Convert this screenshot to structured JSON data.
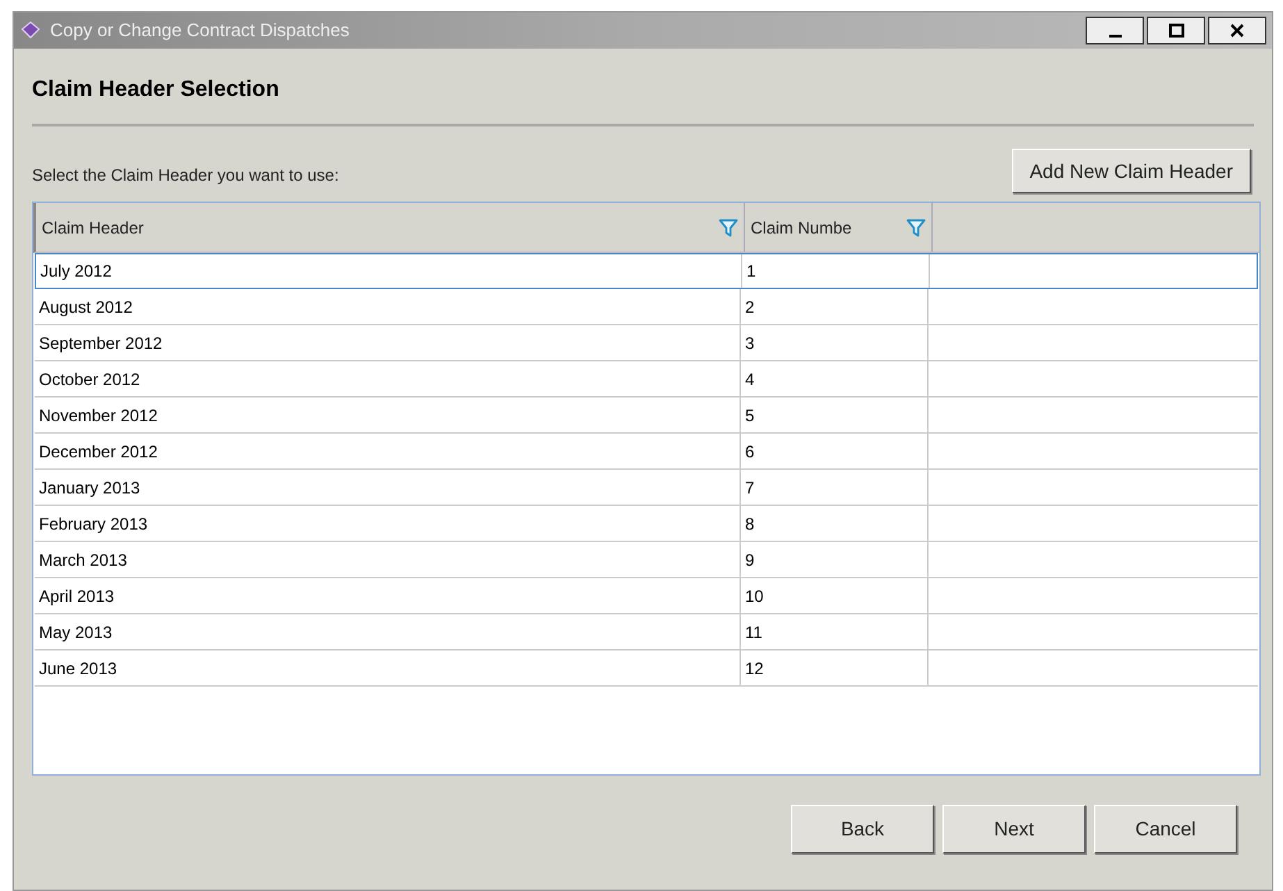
{
  "window": {
    "title": "Copy or Change Contract Dispatches"
  },
  "heading": "Claim Header Selection",
  "prompt": "Select the Claim Header you want to use:",
  "add_button": "Add New Claim Header",
  "table": {
    "columns": [
      {
        "label": "Claim Header",
        "filter": true
      },
      {
        "label": "Claim Numbe",
        "filter": true
      }
    ],
    "rows": [
      {
        "cells": [
          "July 2012",
          "1"
        ],
        "selected": true
      },
      {
        "cells": [
          "August 2012",
          "2"
        ],
        "selected": false
      },
      {
        "cells": [
          "September 2012",
          "3"
        ],
        "selected": false
      },
      {
        "cells": [
          "October 2012",
          "4"
        ],
        "selected": false
      },
      {
        "cells": [
          "November 2012",
          "5"
        ],
        "selected": false
      },
      {
        "cells": [
          "December 2012",
          "6"
        ],
        "selected": false
      },
      {
        "cells": [
          "January 2013",
          "7"
        ],
        "selected": false
      },
      {
        "cells": [
          "February 2013",
          "8"
        ],
        "selected": false
      },
      {
        "cells": [
          "March 2013",
          "9"
        ],
        "selected": false
      },
      {
        "cells": [
          "April 2013",
          "10"
        ],
        "selected": false
      },
      {
        "cells": [
          "May 2013",
          "11"
        ],
        "selected": false
      },
      {
        "cells": [
          "June 2013",
          "12"
        ],
        "selected": false
      }
    ]
  },
  "buttons": [
    "Back",
    "Next",
    "Cancel"
  ]
}
